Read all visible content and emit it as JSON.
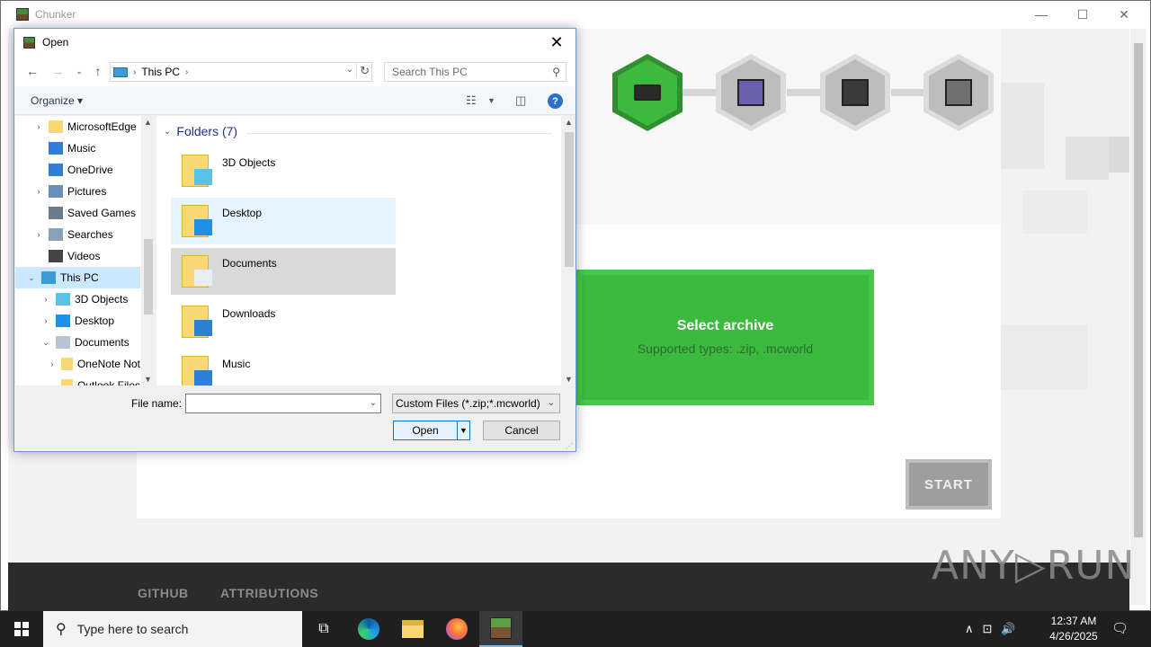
{
  "app": {
    "title": "Chunker",
    "controls": {
      "minimize": "—",
      "maximize": "☐",
      "close": "✕"
    },
    "upload": {
      "title": "Select archive",
      "subtitle": "Supported types: .zip, .mcworld"
    },
    "start_label": "START",
    "footer": {
      "github": "GITHUB",
      "attributions": "ATTRIBUTIONS"
    },
    "watermark": "ANY▷RUN",
    "steps": [
      {
        "name": "select-world",
        "state": "active"
      },
      {
        "name": "settings",
        "state": "pending"
      },
      {
        "name": "convert",
        "state": "pending"
      },
      {
        "name": "complete",
        "state": "pending"
      }
    ],
    "colors": {
      "accent": "#3cba3f",
      "accent_dark": "#2f8f31",
      "footer": "#2b2b2b"
    }
  },
  "dialog": {
    "title": "Open",
    "close": "✕",
    "address": {
      "location": "This PC",
      "sep": "›"
    },
    "search_placeholder": "Search This PC",
    "organize": "Organize ▾",
    "help": "?",
    "nav_tree": [
      {
        "label": "MicrosoftEdge",
        "exp": "›",
        "icon": "folder-icon",
        "color": "#f8d775",
        "selected": false
      },
      {
        "label": "Music",
        "exp": "",
        "icon": "music-icon",
        "color": "#2f7fd6",
        "selected": false
      },
      {
        "label": "OneDrive",
        "exp": "",
        "icon": "onedrive-icon",
        "color": "#2f7fd6",
        "selected": false
      },
      {
        "label": "Pictures",
        "exp": "›",
        "icon": "pictures-icon",
        "color": "#6a8fb8",
        "selected": false
      },
      {
        "label": "Saved Games",
        "exp": "",
        "icon": "saved-games-icon",
        "color": "#6b7b8c",
        "selected": false
      },
      {
        "label": "Searches",
        "exp": "›",
        "icon": "search-folder-icon",
        "color": "#8aa0b5",
        "selected": false
      },
      {
        "label": "Videos",
        "exp": "",
        "icon": "videos-icon",
        "color": "#444444",
        "selected": false
      },
      {
        "label": "This PC",
        "exp": "⌄",
        "icon": "this-pc-icon",
        "color": "#3a9bd9",
        "selected": true
      },
      {
        "label": "3D Objects",
        "exp": "›",
        "icon": "3d-objects-icon",
        "color": "#5bc2e7",
        "selected": false
      },
      {
        "label": "Desktop",
        "exp": "›",
        "icon": "desktop-icon",
        "color": "#1e90e6",
        "selected": false
      },
      {
        "label": "Documents",
        "exp": "⌄",
        "icon": "documents-icon",
        "color": "#b8c4d1",
        "selected": false
      },
      {
        "label": "OneNote Not",
        "exp": "›",
        "icon": "folder-icon",
        "color": "#f8d775",
        "selected": false
      },
      {
        "label": "Outlook Files",
        "exp": "",
        "icon": "folder-icon",
        "color": "#f8d775",
        "selected": false
      }
    ],
    "group_header": "Folders (7)",
    "folders": [
      {
        "name": "3D Objects",
        "icon": "3d-objects-folder-icon",
        "state": "normal",
        "overlay": "#5bc2e7"
      },
      {
        "name": "Desktop",
        "icon": "desktop-folder-icon",
        "state": "hover",
        "overlay": "#1e90e6"
      },
      {
        "name": "Documents",
        "icon": "documents-folder-icon",
        "state": "selected",
        "overlay": "#e8eef4"
      },
      {
        "name": "Downloads",
        "icon": "downloads-folder-icon",
        "state": "normal",
        "overlay": "#2f7fd6"
      },
      {
        "name": "Music",
        "icon": "music-folder-icon",
        "state": "normal",
        "overlay": "#2f7fd6"
      }
    ],
    "file_name_label": "File name:",
    "file_name_value": "",
    "filter": "Custom Files (*.zip;*.mcworld)",
    "open_label": "Open",
    "cancel_label": "Cancel"
  },
  "taskbar": {
    "search_placeholder": "Type here to search",
    "apps": [
      {
        "name": "task-view",
        "active": false
      },
      {
        "name": "edge",
        "active": false
      },
      {
        "name": "file-explorer",
        "active": false
      },
      {
        "name": "firefox",
        "active": false
      },
      {
        "name": "chunker",
        "active": true
      }
    ],
    "tray": {
      "chevron": "∧",
      "network": "⊡",
      "volume": "🔊"
    },
    "time": "12:37 AM",
    "date": "4/26/2025",
    "notifications": "🗨"
  }
}
